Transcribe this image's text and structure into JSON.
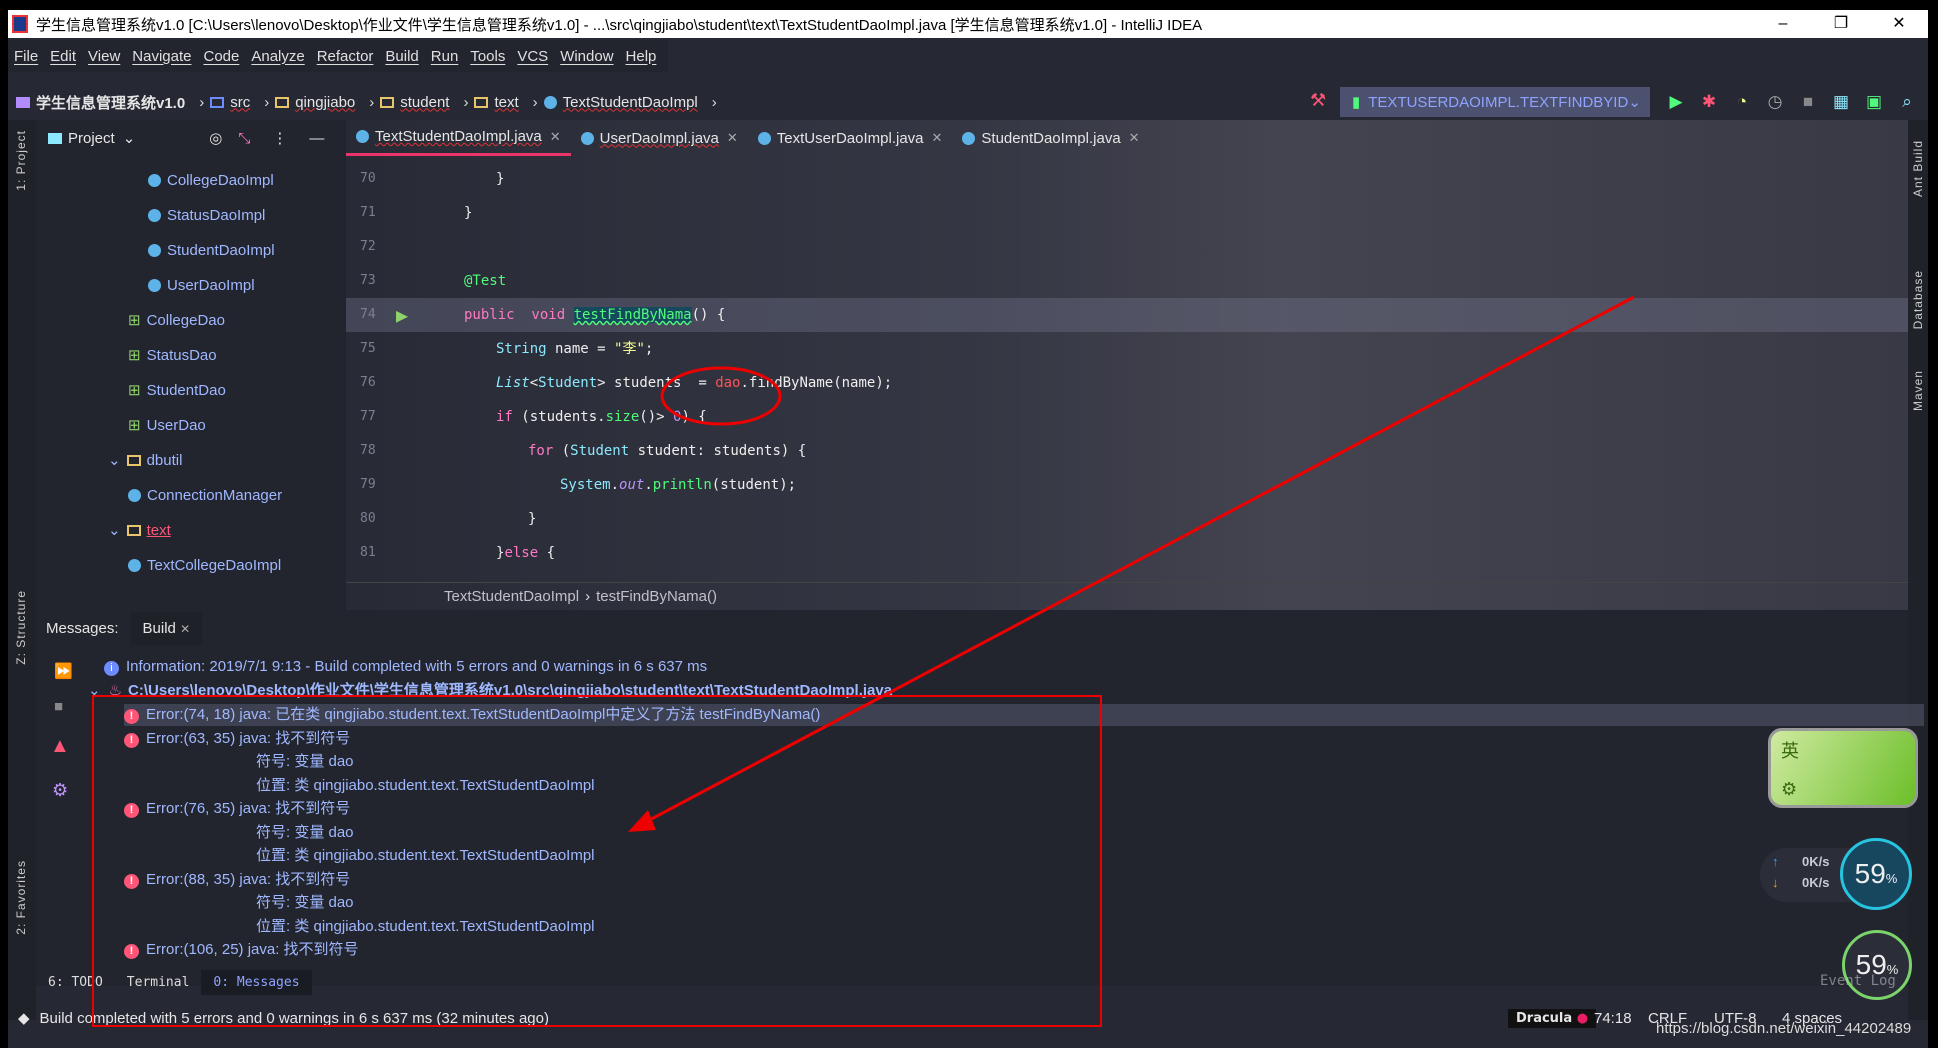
{
  "title": "学生信息管理系统v1.0 [C:\\Users\\lenovo\\Desktop\\作业文件\\学生信息管理系统v1.0] - ...\\src\\qingjiabo\\student\\text\\TextStudentDaoImpl.java [学生信息管理系统v1.0] - IntelliJ IDEA",
  "window_controls": [
    "–",
    "❐",
    "✕"
  ],
  "menu": [
    "File",
    "Edit",
    "View",
    "Navigate",
    "Code",
    "Analyze",
    "Refactor",
    "Build",
    "Run",
    "Tools",
    "VCS",
    "Window",
    "Help"
  ],
  "nav": {
    "project": "学生信息管理系统v1.0",
    "crumbs": [
      "src",
      "qingjiabo",
      "student",
      "text",
      "TextStudentDaoImpl"
    ],
    "run_config": "TEXTUSERDAOIMPL.TEXTFINDBYID"
  },
  "project_panel": {
    "title": "Project",
    "items": [
      "CollegeDaoImpl",
      "StatusDaoImpl",
      "StudentDaoImpl",
      "UserDaoImpl",
      "CollegeDao",
      "StatusDao",
      "StudentDao",
      "UserDao",
      "dbutil",
      "ConnectionManager",
      "text",
      "TextCollegeDaoImpl"
    ]
  },
  "side_labels": {
    "project": "1: Project",
    "structure": "Z: Structure",
    "favorites": "2: Favorites",
    "ant": "Ant Build",
    "database": "Database",
    "maven": "Maven"
  },
  "tabs": [
    "TextStudentDaoImpl.java",
    "UserDaoImpl.java",
    "TextUserDaoImpl.java",
    "StudentDaoImpl.java"
  ],
  "code": {
    "line_numbers": [
      "70",
      "71",
      "72",
      "73",
      "74",
      "75",
      "76",
      "77",
      "78",
      "79",
      "80",
      "81"
    ]
  },
  "editor_breadcrumb": [
    "TextStudentDaoImpl",
    "testFindByNama()"
  ],
  "messages": {
    "label": "Messages:",
    "tab": "Build",
    "info": "Information: 2019/7/1 9:13 - Build completed with 5 errors and 0 warnings in 6 s 637 ms",
    "file": "C:\\Users\\lenovo\\Desktop\\作业文件\\学生信息管理系统v1.0\\src\\qingjiabo\\student\\text\\TextStudentDaoImpl.java",
    "errors": [
      {
        "head": "Error:(74, 18)  java: 已在类 qingjiabo.student.text.TextStudentDaoImpl中定义了方法 testFindByNama()",
        "sub": []
      },
      {
        "head": "Error:(63, 35)  java: 找不到符号",
        "sub": [
          "符号:   变量 dao",
          "位置: 类 qingjiabo.student.text.TextStudentDaoImpl"
        ]
      },
      {
        "head": "Error:(76, 35)  java: 找不到符号",
        "sub": [
          "符号:   变量 dao",
          "位置: 类 qingjiabo.student.text.TextStudentDaoImpl"
        ]
      },
      {
        "head": "Error:(88, 35)  java: 找不到符号",
        "sub": [
          "符号:   变量 dao",
          "位置: 类 qingjiabo.student.text.TextStudentDaoImpl"
        ]
      },
      {
        "head": "Error:(106, 25)  java: 找不到符号",
        "sub": []
      }
    ]
  },
  "bottom_tabs": [
    "6: TODO",
    "Terminal",
    "0: Messages"
  ],
  "status": {
    "message": "Build completed with 5 errors and 0 warnings in 6 s 637 ms (32 minutes ago)",
    "theme": "Dracula",
    "position": "74:18",
    "line_sep": "CRLF",
    "encoding": "UTF-8",
    "indent": "4 spaces"
  },
  "overlay": {
    "ime": "英",
    "net_up": "0K/s",
    "net_down": "0K/s",
    "cpu": "59",
    "cpu_unit": "%",
    "watermark": "https://blog.csdn.net/weixin_44202489",
    "event_log": "Event Log"
  },
  "colors": {
    "accent": "#e9356a",
    "annotation": "#ff0000"
  }
}
